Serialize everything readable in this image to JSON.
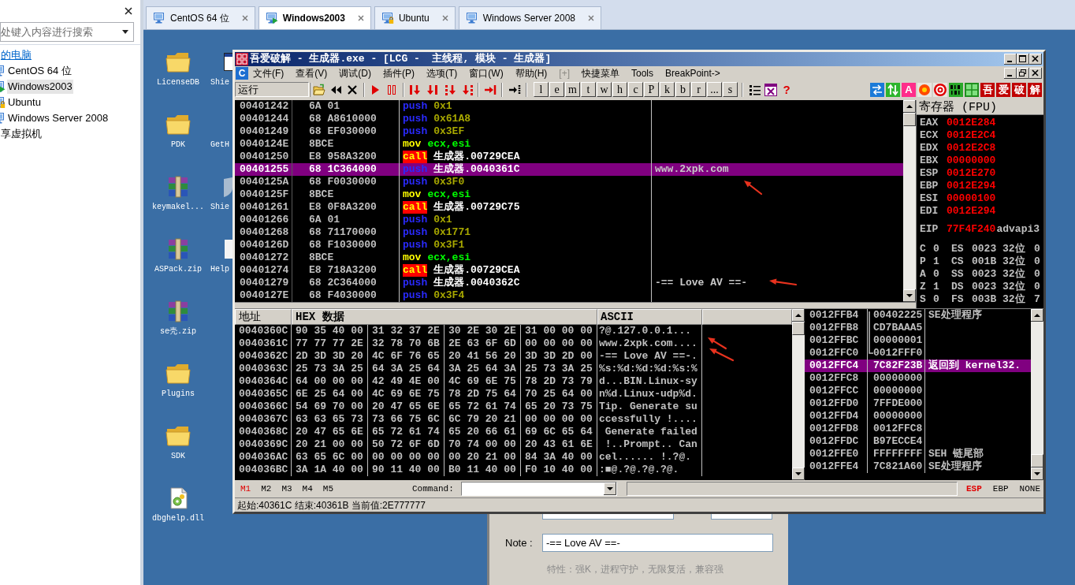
{
  "library": {
    "search": {
      "placeholder": "处键入内容进行搜索"
    },
    "tree": [
      {
        "label": "的电脑",
        "selected": false,
        "hovered": true,
        "children": [
          {
            "label": "CentOS 64 位",
            "selected": false,
            "kind": "off"
          },
          {
            "label": "Windows2003",
            "selected": true,
            "kind": "running"
          },
          {
            "label": "Ubuntu",
            "selected": false,
            "kind": "locked"
          },
          {
            "label": "Windows Server 2008",
            "selected": false,
            "kind": "off"
          }
        ]
      },
      {
        "label": "享虚拟机",
        "selected": false,
        "hovered": false
      }
    ]
  },
  "tabs": [
    {
      "label": "CentOS 64 位",
      "selected": false,
      "kind": "off"
    },
    {
      "label": "Windows2003",
      "selected": true,
      "kind": "running"
    },
    {
      "label": "Ubuntu",
      "selected": false,
      "kind": "locked"
    },
    {
      "label": "Windows Server 2008",
      "selected": false,
      "kind": "off"
    }
  ],
  "desktop": {
    "icons": [
      {
        "label": "LicenseDB",
        "kind": "folder"
      },
      {
        "label": "PDK",
        "kind": "folder"
      },
      {
        "label": "keymakel...",
        "kind": "archive"
      },
      {
        "label": "ASPack.zip",
        "kind": "archive"
      },
      {
        "label": "se壳.zip",
        "kind": "archive"
      },
      {
        "label": "Plugins",
        "kind": "folder"
      },
      {
        "label": "SDK",
        "kind": "folder"
      },
      {
        "label": "dbghelp.dll",
        "kind": "dll"
      }
    ],
    "covered_icons": [
      {
        "label": "Shie",
        "kind": "window"
      },
      {
        "label": "GetH"
      },
      {
        "label": "Shie",
        "kind": "shield"
      },
      {
        "label": "Help",
        "kind": "page"
      }
    ]
  },
  "debugger": {
    "title": "吾爱破解 - 生成器.exe - [LCG -  主线程, 模块 - 生成器]",
    "menu_badge": "C",
    "menu": [
      {
        "label": "文件(F)",
        "disabled": false
      },
      {
        "label": "查看(V)",
        "disabled": false
      },
      {
        "label": "调试(D)",
        "disabled": false
      },
      {
        "label": "插件(P)",
        "disabled": false
      },
      {
        "label": "选项(T)",
        "disabled": false
      },
      {
        "label": "窗口(W)",
        "disabled": false
      },
      {
        "label": "帮助(H)",
        "disabled": false
      },
      {
        "label": "[+]",
        "disabled": true
      },
      {
        "label": "快捷菜单",
        "disabled": false
      },
      {
        "label": "Tools",
        "disabled": false
      },
      {
        "label": "BreakPoint->",
        "disabled": false
      }
    ],
    "toolbar": {
      "status": "运行",
      "letters": [
        "l",
        "e",
        "m",
        "t",
        "w",
        "h",
        "c",
        "P",
        "k",
        "b",
        "r",
        "...",
        "s"
      ],
      "help": "?",
      "badge": "A",
      "brand": [
        "吾",
        "爱",
        "破",
        "解"
      ]
    },
    "disassembly": [
      {
        "address": "00401242",
        "hex": "6A 01",
        "kind": "push",
        "mnemonic": "push",
        "operand": "0x1",
        "selected": false
      },
      {
        "address": "00401244",
        "hex": "68 A8610000",
        "kind": "push",
        "mnemonic": "push",
        "operand": "0x61A8",
        "selected": false
      },
      {
        "address": "00401249",
        "hex": "68 EF030000",
        "kind": "push",
        "mnemonic": "push",
        "operand": "0x3EF",
        "selected": false
      },
      {
        "address": "0040124E",
        "hex": "8BCE",
        "kind": "mov",
        "mnemonic": "mov",
        "operand": "ecx,esi",
        "selected": false
      },
      {
        "address": "00401250",
        "hex": "E8 958A3200",
        "kind": "call",
        "mnemonic": "call",
        "operand": "生成器.00729CEA",
        "selected": false
      },
      {
        "address": "00401255",
        "hex": "68 1C364000",
        "kind": "pushref",
        "mnemonic": "push",
        "operand": "生成器.0040361C",
        "comment": "www.2xpk.com",
        "selected": true
      },
      {
        "address": "0040125A",
        "hex": "68 F0030000",
        "kind": "push",
        "mnemonic": "push",
        "operand": "0x3F0",
        "selected": false
      },
      {
        "address": "0040125F",
        "hex": "8BCE",
        "kind": "mov",
        "mnemonic": "mov",
        "operand": "ecx,esi",
        "selected": false
      },
      {
        "address": "00401261",
        "hex": "E8 0F8A3200",
        "kind": "call",
        "mnemonic": "call",
        "operand": "生成器.00729C75",
        "selected": false
      },
      {
        "address": "00401266",
        "hex": "6A 01",
        "kind": "push",
        "mnemonic": "push",
        "operand": "0x1",
        "selected": false
      },
      {
        "address": "00401268",
        "hex": "68 71170000",
        "kind": "push",
        "mnemonic": "push",
        "operand": "0x1771",
        "selected": false
      },
      {
        "address": "0040126D",
        "hex": "68 F1030000",
        "kind": "push",
        "mnemonic": "push",
        "operand": "0x3F1",
        "selected": false
      },
      {
        "address": "00401272",
        "hex": "8BCE",
        "kind": "mov",
        "mnemonic": "mov",
        "operand": "ecx,esi",
        "selected": false
      },
      {
        "address": "00401274",
        "hex": "E8 718A3200",
        "kind": "call",
        "mnemonic": "call",
        "operand": "生成器.00729CEA",
        "selected": false
      },
      {
        "address": "00401279",
        "hex": "68 2C364000",
        "kind": "pushref",
        "mnemonic": "push",
        "operand": "生成器.0040362C",
        "comment": "-== Love AV ==-",
        "selected": false
      },
      {
        "address": "0040127E",
        "hex": "68 F4030000",
        "kind": "push",
        "mnemonic": "push",
        "operand": "0x3F4",
        "selected": false
      }
    ],
    "registers": {
      "title": "寄存器 (FPU)",
      "general": [
        {
          "name": "EAX",
          "value": "0012E284",
          "changed": true
        },
        {
          "name": "ECX",
          "value": "0012E2C4",
          "changed": true
        },
        {
          "name": "EDX",
          "value": "0012E2C8",
          "changed": true
        },
        {
          "name": "EBX",
          "value": "00000000",
          "changed": true
        },
        {
          "name": "ESP",
          "value": "0012E270",
          "changed": true
        },
        {
          "name": "EBP",
          "value": "0012E294",
          "changed": true
        },
        {
          "name": "ESI",
          "value": "00000100",
          "changed": true
        },
        {
          "name": "EDI",
          "value": "0012E294",
          "changed": true
        }
      ],
      "eip": {
        "name": "EIP",
        "value": "77F4F240",
        "changed": true,
        "comment": "advapi3"
      },
      "flags": [
        {
          "flag": "C",
          "bit": "0",
          "segment": "ES",
          "selector": "0023",
          "size": "32位",
          "column_6": "0"
        },
        {
          "flag": "P",
          "bit": "1",
          "segment": "CS",
          "selector": "001B",
          "size": "32位",
          "column_6": "0"
        },
        {
          "flag": "A",
          "bit": "0",
          "segment": "SS",
          "selector": "0023",
          "size": "32位",
          "column_6": "0"
        },
        {
          "flag": "Z",
          "bit": "1",
          "segment": "DS",
          "selector": "0023",
          "size": "32位",
          "column_6": "0"
        },
        {
          "flag": "S",
          "bit": "0",
          "segment": "FS",
          "selector": "003B",
          "size": "32位",
          "column_6": "7"
        }
      ]
    },
    "dump": {
      "columns": [
        "地址",
        "HEX 数据",
        "ASCII"
      ],
      "rows": [
        {
          "address": "0040360C",
          "hex": [
            "90 35 40 00",
            "31 32 37 2E",
            "30 2E 30 2E",
            "31 00 00 00"
          ],
          "ascii": "?@.127.0.0.1..."
        },
        {
          "address": "0040361C",
          "hex": [
            "77 77 77 2E",
            "32 78 70 6B",
            "2E 63 6F 6D",
            "00 00 00 00"
          ],
          "ascii": "www.2xpk.com...."
        },
        {
          "address": "0040362C",
          "hex": [
            "2D 3D 3D 20",
            "4C 6F 76 65",
            "20 41 56 20",
            "3D 3D 2D 00"
          ],
          "ascii": "-== Love AV ==-."
        },
        {
          "address": "0040363C",
          "hex": [
            "25 73 3A 25",
            "64 3A 25 64",
            "3A 25 64 3A",
            "25 73 3A 25"
          ],
          "ascii": "%s:%d:%d:%d:%s:%"
        },
        {
          "address": "0040364C",
          "hex": [
            "64 00 00 00",
            "42 49 4E 00",
            "4C 69 6E 75",
            "78 2D 73 79"
          ],
          "ascii": "d...BIN.Linux-sy"
        },
        {
          "address": "0040365C",
          "hex": [
            "6E 25 64 00",
            "4C 69 6E 75",
            "78 2D 75 64",
            "70 25 64 00"
          ],
          "ascii": "n%d.Linux-udp%d."
        },
        {
          "address": "0040366C",
          "hex": [
            "54 69 70 00",
            "20 47 65 6E",
            "65 72 61 74",
            "65 20 73 75"
          ],
          "ascii": "Tip. Generate su"
        },
        {
          "address": "0040367C",
          "hex": [
            "63 63 65 73",
            "73 66 75 6C",
            "6C 79 20 21",
            "00 00 00 00"
          ],
          "ascii": "ccessfully !...."
        },
        {
          "address": "0040368C",
          "hex": [
            "20 47 65 6E",
            "65 72 61 74",
            "65 20 66 61",
            "69 6C 65 64"
          ],
          "ascii": " Generate failed"
        },
        {
          "address": "0040369C",
          "hex": [
            "20 21 00 00",
            "50 72 6F 6D",
            "70 74 00 00",
            "20 43 61 6E"
          ],
          "ascii": " !..Prompt.. Can"
        },
        {
          "address": "004036AC",
          "hex": [
            "63 65 6C 00",
            "00 00 00 00",
            "00 20 21 00",
            "84 3A 40 00"
          ],
          "ascii": "cel...... !.?@."
        },
        {
          "address": "004036BC",
          "hex": [
            "3A 1A 40 00",
            "90 11 40 00",
            "B0 11 40 00",
            "F0 10 40 00"
          ],
          "ascii": ":■@.?@.?@.?@."
        }
      ]
    },
    "stack": [
      {
        "address": "0012FFB4",
        "value": "00402225",
        "comment": "SE处理程序",
        "selected": false
      },
      {
        "address": "0012FFB8",
        "value": "CD7BAAA5",
        "selected": false
      },
      {
        "address": "0012FFBC",
        "value": "00000001",
        "selected": false
      },
      {
        "address": "0012FFC0",
        "value": "0012FFF0",
        "selected": false
      },
      {
        "address": "0012FFC4",
        "value": "7C82F23B",
        "comment": "返回到 kernel32.",
        "selected": true
      },
      {
        "address": "0012FFC8",
        "value": "00000000",
        "selected": false
      },
      {
        "address": "0012FFCC",
        "value": "00000000",
        "selected": false
      },
      {
        "address": "0012FFD0",
        "value": "7FFDE000",
        "selected": false
      },
      {
        "address": "0012FFD4",
        "value": "00000000",
        "selected": false
      },
      {
        "address": "0012FFD8",
        "value": "0012FFC8",
        "selected": false
      },
      {
        "address": "0012FFDC",
        "value": "B97ECCE4",
        "selected": false
      },
      {
        "address": "0012FFE0",
        "value": "FFFFFFFF",
        "comment": "SEH 链尾部",
        "selected": false
      },
      {
        "address": "0012FFE4",
        "value": "7C821A60",
        "comment": "SE处理程序",
        "selected": false
      }
    ],
    "memory_tabs": [
      {
        "label": "M1",
        "selected": true
      },
      {
        "label": "M2",
        "selected": false
      },
      {
        "label": "M3",
        "selected": false
      },
      {
        "label": "M4",
        "selected": false
      },
      {
        "label": "M5",
        "selected": false
      }
    ],
    "command_label": "Command:",
    "stack_modes": [
      {
        "label": "ESP",
        "selected": true
      },
      {
        "label": "EBP",
        "selected": false
      },
      {
        "label": "NONE",
        "selected": false
      }
    ],
    "status": "起始:40361C 结束:40361B 当前值:2E777777"
  },
  "dialog": {
    "note_label": "Note :",
    "note_value": "-== Love AV ==-",
    "features": "特性：强K，进程守护，无限复活，兼容强"
  }
}
